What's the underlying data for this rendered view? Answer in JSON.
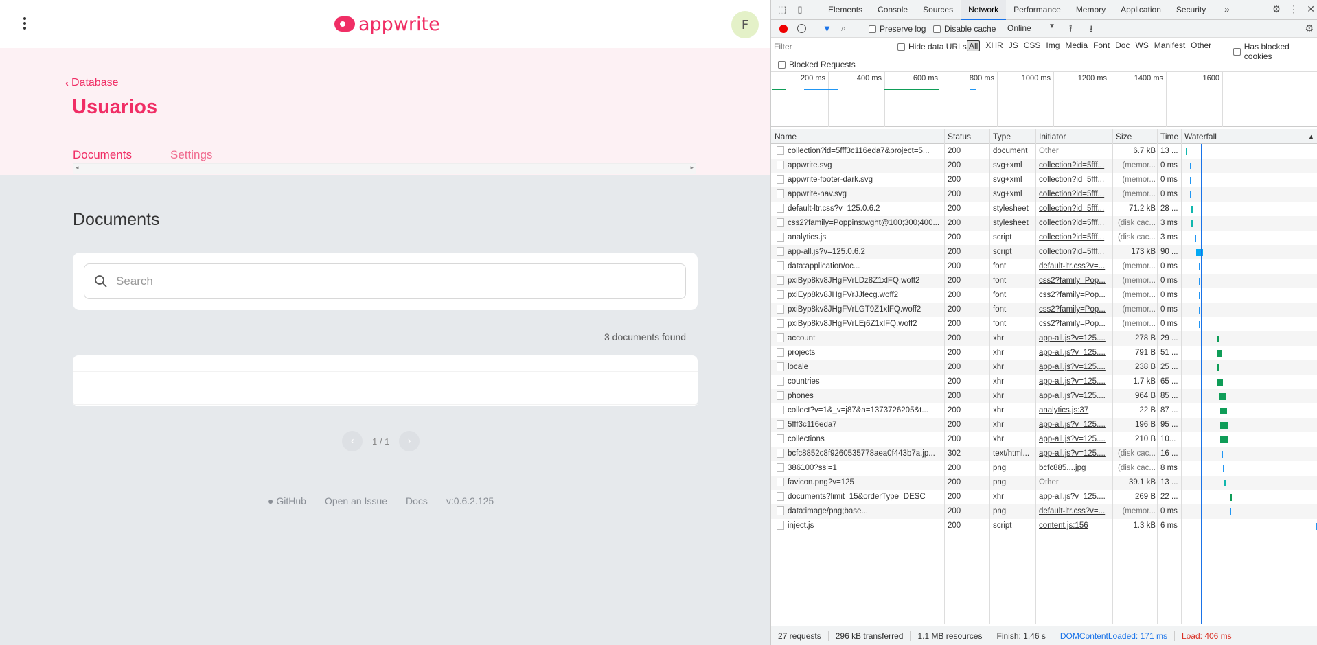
{
  "app": {
    "brand": "appwrite",
    "avatar_initial": "F",
    "breadcrumb": "Database",
    "page_title": "Usuarios",
    "tabs": [
      {
        "label": "Documents",
        "active": true
      },
      {
        "label": "Settings",
        "active": false
      }
    ],
    "section_title": "Documents",
    "search_placeholder": "Search",
    "found_text": "3 documents found",
    "pager": "1 / 1",
    "footer": {
      "github": "GitHub",
      "issue": "Open an Issue",
      "docs": "Docs",
      "version": "v:0.6.2.125"
    },
    "accent": "#f02e65"
  },
  "devtools": {
    "tabs": [
      "Elements",
      "Console",
      "Sources",
      "Network",
      "Performance",
      "Memory",
      "Application",
      "Security"
    ],
    "active_tab": "Network",
    "more": "»",
    "preserve_log": "Preserve log",
    "disable_cache": "Disable cache",
    "throttle": "Online",
    "filter_placeholder": "Filter",
    "hide_data_urls": "Hide data URLs",
    "types": [
      "All",
      "XHR",
      "JS",
      "CSS",
      "Img",
      "Media",
      "Font",
      "Doc",
      "WS",
      "Manifest",
      "Other"
    ],
    "has_blocked": "Has blocked cookies",
    "blocked_requests": "Blocked Requests",
    "timeline_labels": [
      "200 ms",
      "400 ms",
      "600 ms",
      "800 ms",
      "1000 ms",
      "1200 ms",
      "1400 ms",
      "1600"
    ],
    "columns": {
      "name": "Name",
      "status": "Status",
      "type": "Type",
      "initiator": "Initiator",
      "size": "Size",
      "time": "Time",
      "waterfall": "Waterfall"
    },
    "requests": [
      {
        "name": "collection?id=5fff3c116eda7&project=5...",
        "status": "200",
        "type": "document",
        "initiator": "Other",
        "size": "6.7 kB",
        "time": "13 ...",
        "w_start": 0.02,
        "w_len": 0.01,
        "color": "#11b7ad"
      },
      {
        "name": "appwrite.svg",
        "status": "200",
        "type": "svg+xml",
        "initiator": "collection?id=5fff...",
        "size": "(memor...",
        "time": "0 ms",
        "w_start": 0.05,
        "w_len": 0.005,
        "color": "#2196f3"
      },
      {
        "name": "appwrite-footer-dark.svg",
        "status": "200",
        "type": "svg+xml",
        "initiator": "collection?id=5fff...",
        "size": "(memor...",
        "time": "0 ms",
        "w_start": 0.05,
        "w_len": 0.005,
        "color": "#2196f3"
      },
      {
        "name": "appwrite-nav.svg",
        "status": "200",
        "type": "svg+xml",
        "initiator": "collection?id=5fff...",
        "size": "(memor...",
        "time": "0 ms",
        "w_start": 0.05,
        "w_len": 0.005,
        "color": "#2196f3"
      },
      {
        "name": "default-ltr.css?v=125.0.6.2",
        "status": "200",
        "type": "stylesheet",
        "initiator": "collection?id=5fff...",
        "size": "71.2 kB",
        "time": "28 ...",
        "w_start": 0.06,
        "w_len": 0.012,
        "color": "#11b7ad"
      },
      {
        "name": "css2?family=Poppins:wght@100;300;400...",
        "status": "200",
        "type": "stylesheet",
        "initiator": "collection?id=5fff...",
        "size": "(disk cac...",
        "time": "3 ms",
        "w_start": 0.06,
        "w_len": 0.005,
        "color": "#11b7ad"
      },
      {
        "name": "analytics.js",
        "status": "200",
        "type": "script",
        "initiator": "collection?id=5fff...",
        "size": "(disk cac...",
        "time": "3 ms",
        "w_start": 0.09,
        "w_len": 0.005,
        "color": "#2196f3"
      },
      {
        "name": "app-all.js?v=125.0.6.2",
        "status": "200",
        "type": "script",
        "initiator": "collection?id=5fff...",
        "size": "173 kB",
        "time": "90 ...",
        "w_start": 0.1,
        "w_len": 0.05,
        "color": "#03a9f4"
      },
      {
        "name": "data:application/oc...",
        "status": "200",
        "type": "font",
        "initiator": "default-ltr.css?v=...",
        "size": "(memor...",
        "time": "0 ms",
        "w_start": 0.12,
        "w_len": 0.005,
        "color": "#2196f3"
      },
      {
        "name": "pxiByp8kv8JHgFVrLDz8Z1xlFQ.woff2",
        "status": "200",
        "type": "font",
        "initiator": "css2?family=Pop...",
        "size": "(memor...",
        "time": "0 ms",
        "w_start": 0.12,
        "w_len": 0.005,
        "color": "#2196f3"
      },
      {
        "name": "pxiEyp8kv8JHgFVrJJfecg.woff2",
        "status": "200",
        "type": "font",
        "initiator": "css2?family=Pop...",
        "size": "(memor...",
        "time": "0 ms",
        "w_start": 0.12,
        "w_len": 0.005,
        "color": "#2196f3"
      },
      {
        "name": "pxiByp8kv8JHgFVrLGT9Z1xlFQ.woff2",
        "status": "200",
        "type": "font",
        "initiator": "css2?family=Pop...",
        "size": "(memor...",
        "time": "0 ms",
        "w_start": 0.12,
        "w_len": 0.005,
        "color": "#2196f3"
      },
      {
        "name": "pxiByp8kv8JHgFVrLEj6Z1xlFQ.woff2",
        "status": "200",
        "type": "font",
        "initiator": "css2?family=Pop...",
        "size": "(memor...",
        "time": "0 ms",
        "w_start": 0.12,
        "w_len": 0.005,
        "color": "#2196f3"
      },
      {
        "name": "account",
        "status": "200",
        "type": "xhr",
        "initiator": "app-all.js?v=125....",
        "size": "278 B",
        "time": "29 ...",
        "w_start": 0.25,
        "w_len": 0.02,
        "color": "#0f9d58"
      },
      {
        "name": "projects",
        "status": "200",
        "type": "xhr",
        "initiator": "app-all.js?v=125....",
        "size": "791 B",
        "time": "51 ...",
        "w_start": 0.26,
        "w_len": 0.03,
        "color": "#0f9d58"
      },
      {
        "name": "locale",
        "status": "200",
        "type": "xhr",
        "initiator": "app-all.js?v=125....",
        "size": "238 B",
        "time": "25 ...",
        "w_start": 0.26,
        "w_len": 0.015,
        "color": "#0f9d58"
      },
      {
        "name": "countries",
        "status": "200",
        "type": "xhr",
        "initiator": "app-all.js?v=125....",
        "size": "1.7 kB",
        "time": "65 ...",
        "w_start": 0.26,
        "w_len": 0.04,
        "color": "#0f9d58"
      },
      {
        "name": "phones",
        "status": "200",
        "type": "xhr",
        "initiator": "app-all.js?v=125....",
        "size": "964 B",
        "time": "85 ...",
        "w_start": 0.27,
        "w_len": 0.05,
        "color": "#0f9d58"
      },
      {
        "name": "collect?v=1&_v=j87&a=1373726205&t...",
        "status": "200",
        "type": "xhr",
        "initiator": "analytics.js:37",
        "size": "22 B",
        "time": "87 ...",
        "w_start": 0.28,
        "w_len": 0.05,
        "color": "#0f9d58"
      },
      {
        "name": "5fff3c116eda7",
        "status": "200",
        "type": "xhr",
        "initiator": "app-all.js?v=125....",
        "size": "196 B",
        "time": "95 ...",
        "w_start": 0.28,
        "w_len": 0.055,
        "color": "#0f9d58"
      },
      {
        "name": "collections",
        "status": "200",
        "type": "xhr",
        "initiator": "app-all.js?v=125....",
        "size": "210 B",
        "time": "10...",
        "w_start": 0.28,
        "w_len": 0.06,
        "color": "#0f9d58"
      },
      {
        "name": "bcfc8852c8f9260535778aea0f443b7a.jp...",
        "status": "302",
        "type": "text/html...",
        "initiator": "app-all.js?v=125....",
        "size": "(disk cac...",
        "time": "16 ...",
        "w_start": 0.29,
        "w_len": 0.01,
        "color": "#2196f3"
      },
      {
        "name": "386100?ssl=1",
        "status": "200",
        "type": "png",
        "initiator": "bcfc885....jpg",
        "size": "(disk cac...",
        "time": "8 ms",
        "w_start": 0.3,
        "w_len": 0.005,
        "color": "#2196f3"
      },
      {
        "name": "favicon.png?v=125",
        "status": "200",
        "type": "png",
        "initiator": "Other",
        "size": "39.1 kB",
        "time": "13 ...",
        "w_start": 0.31,
        "w_len": 0.01,
        "color": "#11b7ad"
      },
      {
        "name": "documents?limit=15&orderType=DESC",
        "status": "200",
        "type": "xhr",
        "initiator": "app-all.js?v=125....",
        "size": "269 B",
        "time": "22 ...",
        "w_start": 0.35,
        "w_len": 0.015,
        "color": "#0f9d58"
      },
      {
        "name": "data:image/png;base...",
        "status": "200",
        "type": "png",
        "initiator": "default-ltr.css?v=...",
        "size": "(memor...",
        "time": "0 ms",
        "w_start": 0.35,
        "w_len": 0.005,
        "color": "#2196f3"
      },
      {
        "name": "inject.js",
        "status": "200",
        "type": "script",
        "initiator": "content.js:156",
        "size": "1.3 kB",
        "time": "6 ms",
        "w_start": 0.995,
        "w_len": 0.005,
        "color": "#2196f3"
      }
    ],
    "summary": {
      "requests": "27 requests",
      "transferred": "296 kB transferred",
      "resources": "1.1 MB resources",
      "finish": "Finish: 1.46 s",
      "dcl": "DOMContentLoaded: 171 ms",
      "load": "Load: 406 ms"
    }
  }
}
